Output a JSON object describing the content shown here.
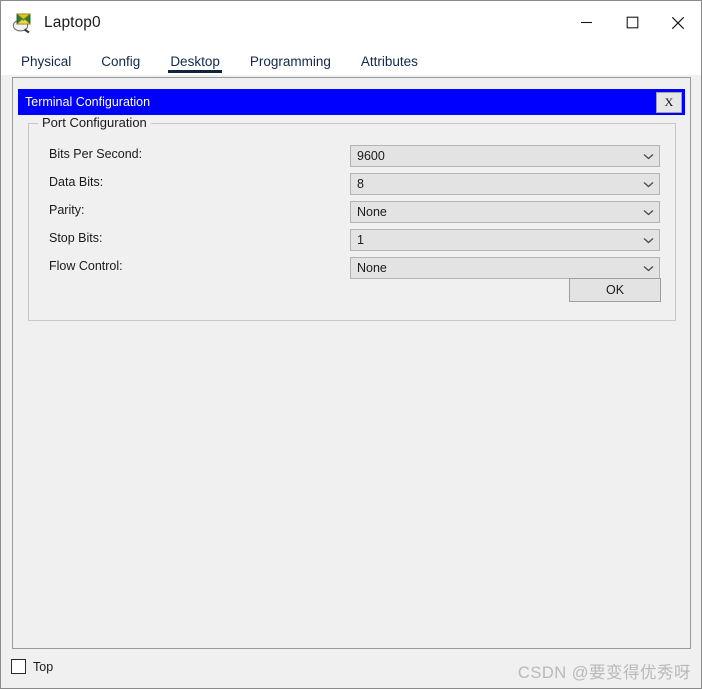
{
  "window": {
    "title": "Laptop0",
    "icon": "packet-tracer-laptop-icon",
    "minimize_label": "─",
    "maximize_label": "□",
    "close_label": "✕"
  },
  "tabs": [
    {
      "label": "Physical",
      "active": false
    },
    {
      "label": "Config",
      "active": false
    },
    {
      "label": "Desktop",
      "active": true
    },
    {
      "label": "Programming",
      "active": false
    },
    {
      "label": "Attributes",
      "active": false
    }
  ],
  "dialog": {
    "title": "Terminal Configuration",
    "close_label": "X",
    "title_bg": "#0000FE",
    "title_fg": "#FFFFFF",
    "group": {
      "legend": "Port Configuration",
      "fields": [
        {
          "label": "Bits Per Second:",
          "value": "9600"
        },
        {
          "label": "Data Bits:",
          "value": "8"
        },
        {
          "label": "Parity:",
          "value": "None"
        },
        {
          "label": "Stop Bits:",
          "value": "1"
        },
        {
          "label": "Flow Control:",
          "value": "None"
        }
      ],
      "ok_label": "OK"
    }
  },
  "bottom": {
    "top_checkbox_label": "Top",
    "top_checkbox_checked": false,
    "watermark": "CSDN @要变得优秀呀"
  }
}
